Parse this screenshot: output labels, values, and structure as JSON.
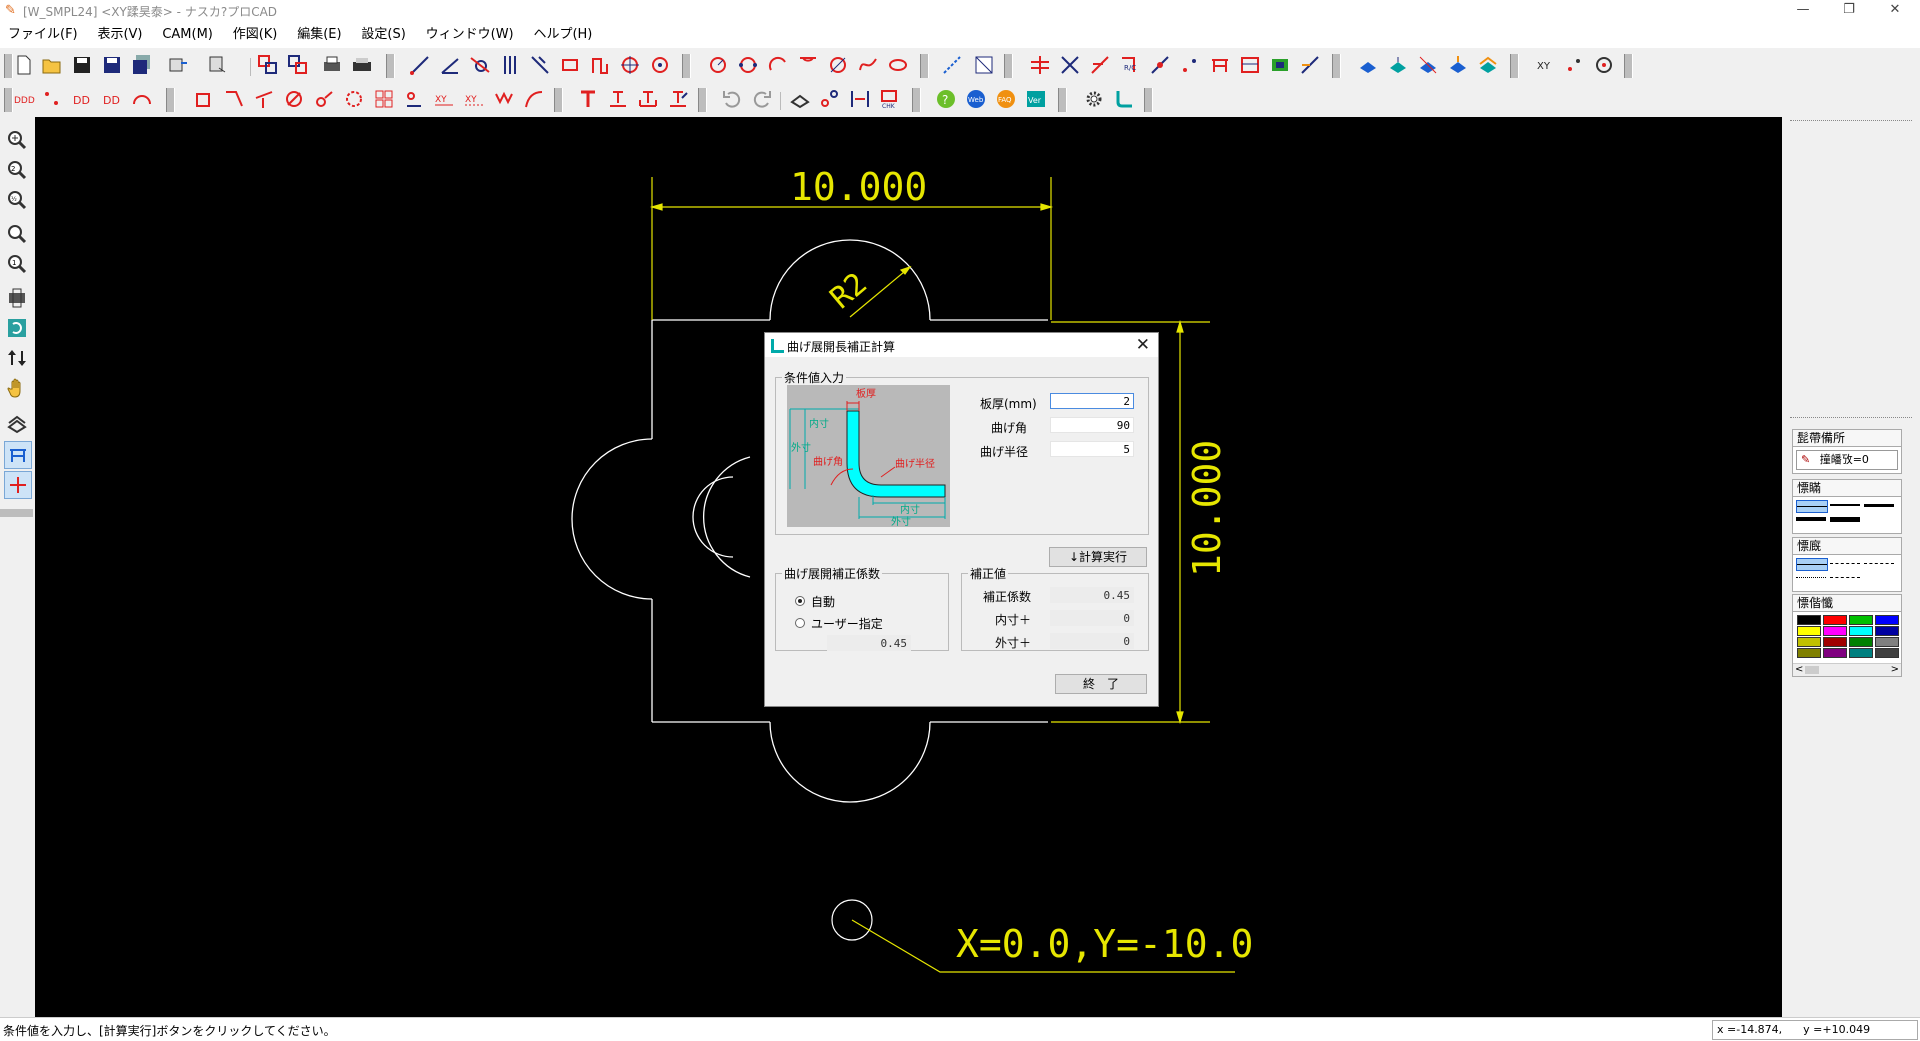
{
  "window": {
    "title": "[W_SMPL24] <XY蹂昊泰> - ナスカ?プロCAD",
    "minimize": "—",
    "restore": "❐",
    "close": "✕"
  },
  "menu": [
    "ファイル(F)",
    "表示(V)",
    "CAM(M)",
    "作図(K)",
    "編集(E)",
    "設定(S)",
    "ウィンドウ(W)",
    "ヘルプ(H)"
  ],
  "toolbar": {
    "rows": 2,
    "colors": {
      "red": "#e02020",
      "navy": "#1e2a7a",
      "blue": "#1a5fd0",
      "teal": "#00a0a0",
      "green": "#2aa02a",
      "orange": "#f09010"
    }
  },
  "drawing": {
    "dim_top": "10.000",
    "dim_right": "10.000",
    "radius_label": "R2",
    "origin_label": "X=0.0,Y=-10.0",
    "line_color": "#ffffff",
    "dim_color": "#e6e600"
  },
  "dialog": {
    "title": "曲げ展開長補正計算",
    "close_glyph": "✕",
    "conditions_legend": "条件値入力",
    "diagram_labels": {
      "thickness": "板厚",
      "inner": "内寸",
      "outer": "外寸",
      "bend_angle": "曲げ角",
      "bend_radius": "曲げ半径",
      "inner_bottom": "内寸",
      "outer_bottom": "外寸"
    },
    "fields": {
      "thickness_label": "板厚(mm)",
      "thickness_value": "2",
      "angle_label": "曲げ角",
      "angle_value": "90",
      "radius_label": "曲げ半径",
      "radius_value": "5"
    },
    "calc_button": "↓計算実行",
    "coef_legend": "曲げ展開補正係数",
    "radio_auto": "自動",
    "radio_user": "ユーザー指定",
    "user_value": "0.45",
    "result_legend": "補正値",
    "result_coef_label": "補正係数",
    "result_coef_value": "0.45",
    "result_inner_label": "内寸＋",
    "result_inner_value": "0",
    "result_outer_label": "外寸＋",
    "result_outer_value": "0",
    "exit_button": "終　了"
  },
  "right_panel": {
    "group1_title": "髭帶備所",
    "group1_item": "撞皤攷=0",
    "group2_title": "慓瞞",
    "group3_title": "慓廐",
    "group4_title": "慓偕懺",
    "palette": [
      "#000000",
      "#ff0000",
      "#00c000",
      "#0000ff",
      "#ffff00",
      "#ff00ff",
      "#00ffff",
      "#0000a0",
      "#c0c000",
      "#a00000",
      "#008000",
      "#808080",
      "#808000",
      "#800080",
      "#008080",
      "#404040"
    ],
    "scroll_left": "<",
    "scroll_right": ">"
  },
  "status": {
    "message": "条件値を入力し、[計算実行]ボタンをクリックしてください。",
    "coords": "x =-14.874,      y =+10.049"
  }
}
